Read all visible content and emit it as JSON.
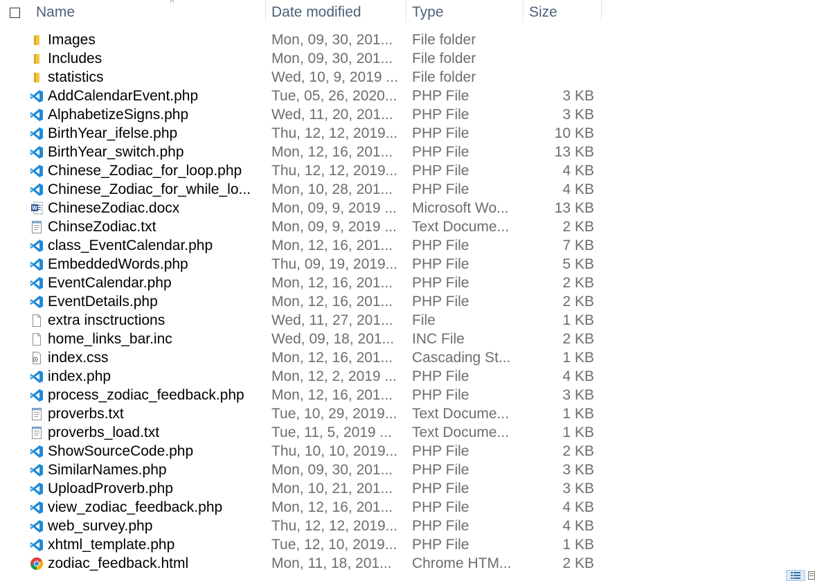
{
  "header": {
    "name": "Name",
    "date_modified": "Date modified",
    "type": "Type",
    "size": "Size"
  },
  "colors": {
    "header_text": "#4c607a",
    "vscode_blue": "#1e8ad8",
    "folder_yellow": "#f4c542",
    "secondary_text": "#6d6d6d"
  },
  "files": [
    {
      "name": "Images",
      "date": "Mon, 09, 30, 201...",
      "type": "File folder",
      "size": "",
      "icon": "folder-icon"
    },
    {
      "name": "Includes",
      "date": "Mon, 09, 30, 201...",
      "type": "File folder",
      "size": "",
      "icon": "folder-icon"
    },
    {
      "name": "statistics",
      "date": "Wed, 10, 9, 2019 ...",
      "type": "File folder",
      "size": "",
      "icon": "folder-icon"
    },
    {
      "name": "AddCalendarEvent.php",
      "date": "Tue, 05, 26, 2020...",
      "type": "PHP File",
      "size": "3 KB",
      "icon": "vscode-file-icon"
    },
    {
      "name": "AlphabetizeSigns.php",
      "date": "Wed, 11, 20, 201...",
      "type": "PHP File",
      "size": "3 KB",
      "icon": "vscode-file-icon"
    },
    {
      "name": "BirthYear_ifelse.php",
      "date": "Thu, 12, 12, 2019...",
      "type": "PHP File",
      "size": "10 KB",
      "icon": "vscode-file-icon"
    },
    {
      "name": "BirthYear_switch.php",
      "date": "Mon, 12, 16, 201...",
      "type": "PHP File",
      "size": "13 KB",
      "icon": "vscode-file-icon"
    },
    {
      "name": "Chinese_Zodiac_for_loop.php",
      "date": "Thu, 12, 12, 2019...",
      "type": "PHP File",
      "size": "4 KB",
      "icon": "vscode-file-icon"
    },
    {
      "name": "Chinese_Zodiac_for_while_lo...",
      "date": "Mon, 10, 28, 201...",
      "type": "PHP File",
      "size": "4 KB",
      "icon": "vscode-file-icon"
    },
    {
      "name": "ChineseZodiac.docx",
      "date": "Mon, 09, 9, 2019 ...",
      "type": "Microsoft Wo...",
      "size": "13 KB",
      "icon": "word-document-icon"
    },
    {
      "name": "ChinseZodiac.txt",
      "date": "Mon, 09, 9, 2019 ...",
      "type": "Text Docume...",
      "size": "2 KB",
      "icon": "text-file-icon"
    },
    {
      "name": "class_EventCalendar.php",
      "date": "Mon, 12, 16, 201...",
      "type": "PHP File",
      "size": "7 KB",
      "icon": "vscode-file-icon"
    },
    {
      "name": "EmbeddedWords.php",
      "date": "Thu, 09, 19, 2019...",
      "type": "PHP File",
      "size": "5 KB",
      "icon": "vscode-file-icon"
    },
    {
      "name": "EventCalendar.php",
      "date": "Mon, 12, 16, 201...",
      "type": "PHP File",
      "size": "2 KB",
      "icon": "vscode-file-icon"
    },
    {
      "name": "EventDetails.php",
      "date": "Mon, 12, 16, 201...",
      "type": "PHP File",
      "size": "2 KB",
      "icon": "vscode-file-icon"
    },
    {
      "name": "extra insctructions",
      "date": "Wed, 11, 27, 201...",
      "type": "File",
      "size": "1 KB",
      "icon": "blank-file-icon"
    },
    {
      "name": "home_links_bar.inc",
      "date": "Wed, 09, 18, 201...",
      "type": "INC File",
      "size": "2 KB",
      "icon": "blank-file-icon"
    },
    {
      "name": "index.css",
      "date": "Mon, 12, 16, 201...",
      "type": "Cascading St...",
      "size": "1 KB",
      "icon": "css-file-icon"
    },
    {
      "name": "index.php",
      "date": "Mon, 12, 2, 2019 ...",
      "type": "PHP File",
      "size": "4 KB",
      "icon": "vscode-file-icon"
    },
    {
      "name": "process_zodiac_feedback.php",
      "date": "Mon, 12, 16, 201...",
      "type": "PHP File",
      "size": "3 KB",
      "icon": "vscode-file-icon"
    },
    {
      "name": "proverbs.txt",
      "date": "Tue, 10, 29, 2019...",
      "type": "Text Docume...",
      "size": "1 KB",
      "icon": "text-file-icon"
    },
    {
      "name": "proverbs_load.txt",
      "date": "Tue, 11, 5, 2019 ...",
      "type": "Text Docume...",
      "size": "1 KB",
      "icon": "text-file-icon"
    },
    {
      "name": "ShowSourceCode.php",
      "date": "Thu, 10, 10, 2019...",
      "type": "PHP File",
      "size": "2 KB",
      "icon": "vscode-file-icon"
    },
    {
      "name": "SimilarNames.php",
      "date": "Mon, 09, 30, 201...",
      "type": "PHP File",
      "size": "3 KB",
      "icon": "vscode-file-icon"
    },
    {
      "name": "UploadProverb.php",
      "date": "Mon, 10, 21, 201...",
      "type": "PHP File",
      "size": "3 KB",
      "icon": "vscode-file-icon"
    },
    {
      "name": "view_zodiac_feedback.php",
      "date": "Mon, 12, 16, 201...",
      "type": "PHP File",
      "size": "4 KB",
      "icon": "vscode-file-icon"
    },
    {
      "name": "web_survey.php",
      "date": "Thu, 12, 12, 2019...",
      "type": "PHP File",
      "size": "4 KB",
      "icon": "vscode-file-icon"
    },
    {
      "name": "xhtml_template.php",
      "date": "Tue, 12, 10, 2019...",
      "type": "PHP File",
      "size": "1 KB",
      "icon": "vscode-file-icon"
    },
    {
      "name": "zodiac_feedback.html",
      "date": "Mon, 11, 18, 201...",
      "type": "Chrome HTM...",
      "size": "2 KB",
      "icon": "chrome-html-icon"
    }
  ]
}
